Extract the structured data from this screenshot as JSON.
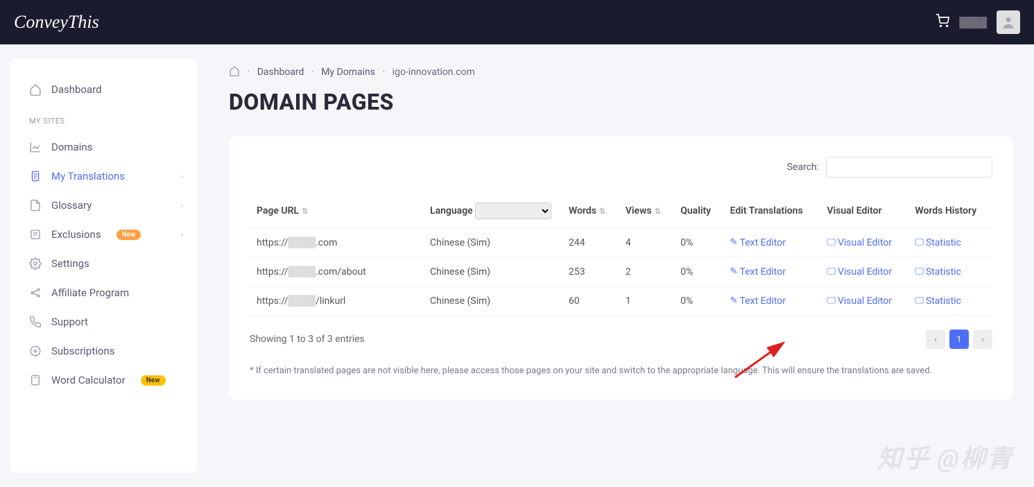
{
  "header": {
    "logo_text": "ConveyThis"
  },
  "sidebar": {
    "dashboard_label": "Dashboard",
    "section_label": "MY SITES",
    "items": [
      {
        "label": "Domains"
      },
      {
        "label": "My Translations"
      },
      {
        "label": "Glossary"
      },
      {
        "label": "Exclusions"
      },
      {
        "label": "Settings"
      },
      {
        "label": "Affiliate Program"
      },
      {
        "label": "Support"
      },
      {
        "label": "Subscriptions"
      },
      {
        "label": "Word Calculator"
      }
    ],
    "badge_new": "New"
  },
  "breadcrumb": {
    "dashboard": "Dashboard",
    "mydomains": "My Domains",
    "current": "igo-innovation.com"
  },
  "page": {
    "title": "DOMAIN PAGES"
  },
  "search": {
    "label": "Search:"
  },
  "table": {
    "headers": {
      "page_url": "Page URL",
      "language": "Language",
      "words": "Words",
      "views": "Views",
      "quality": "Quality",
      "edit_translations": "Edit Translations",
      "visual_editor": "Visual Editor",
      "words_history": "Words History"
    },
    "rows": [
      {
        "url": "https://",
        "url_suffix": ".com",
        "lang": "Chinese (Sim)",
        "words": "244",
        "views": "4",
        "quality": "0%"
      },
      {
        "url": "https://",
        "url_suffix": ".com/about",
        "lang": "Chinese (Sim)",
        "words": "253",
        "views": "2",
        "quality": "0%"
      },
      {
        "url": "https://",
        "url_suffix": "/linkurl",
        "lang": "Chinese (Sim)",
        "words": "60",
        "views": "1",
        "quality": "0%"
      }
    ],
    "link_labels": {
      "text_editor": "Text Editor",
      "visual_editor": "Visual Editor",
      "statistic": "Statistic"
    }
  },
  "footer": {
    "showing": "Showing 1 to 3 of 3 entries",
    "page_1": "1",
    "note": "* If certain translated pages are not visible here, please access those pages on your site and switch to the appropriate language. This will ensure the translations are saved."
  },
  "watermark": "知乎 @柳青"
}
